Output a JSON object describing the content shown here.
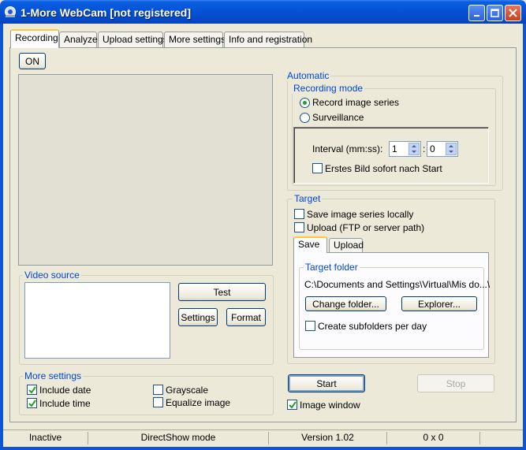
{
  "window": {
    "title": "1-More WebCam [not registered]"
  },
  "tabs": [
    {
      "label": "Recording"
    },
    {
      "label": "Analyze"
    },
    {
      "label": "Upload settings"
    },
    {
      "label": "More settings"
    },
    {
      "label": "Info and registration"
    }
  ],
  "recording": {
    "on_label": "ON",
    "video_source": {
      "title": "Video source",
      "test_label": "Test",
      "settings_label": "Settings",
      "format_label": "Format"
    },
    "more_settings": {
      "title": "More settings",
      "include_date": "Include date",
      "include_time": "Include time",
      "grayscale": "Grayscale",
      "equalize": "Equalize image"
    },
    "automatic": {
      "title": "Automatic",
      "mode_title": "Recording mode",
      "record_series": "Record image series",
      "surveillance": "Surveillance",
      "interval_label": "Interval (mm:ss):",
      "interval_min": "1",
      "interval_sep": ":",
      "interval_sec": "0",
      "first_image": "Erstes Bild sofort nach Start"
    },
    "target": {
      "title": "Target",
      "save_locally": "Save image series locally",
      "upload": "Upload (FTP or server path)",
      "tab_save": "Save",
      "tab_upload": "Upload",
      "folder_title": "Target folder",
      "folder_path": "C:\\Documents and Settings\\Virtual\\Mis do...\\",
      "change_folder": "Change folder...",
      "explorer": "Explorer...",
      "subfolders": "Create subfolders per day"
    },
    "start_label": "Start",
    "stop_label": "Stop",
    "image_window": "Image window"
  },
  "status": {
    "state": "Inactive",
    "mode": "DirectShow mode",
    "version": "Version 1.02",
    "size": "0 x 0"
  },
  "colors": {
    "titlebar": "#0554d8",
    "accent_label": "#0046d5",
    "window_bg": "#ece9d8",
    "check": "#21a121"
  }
}
